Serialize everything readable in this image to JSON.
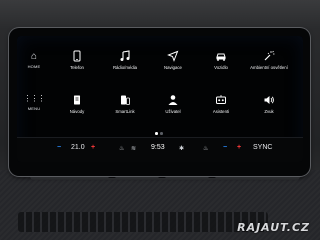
{
  "sidebar": {
    "home_label": "HOME",
    "menu_label": "MENU"
  },
  "apps": [
    {
      "label": "Telefon",
      "icon": "phone-icon"
    },
    {
      "label": "Rádio/média",
      "icon": "music-note-icon"
    },
    {
      "label": "Navigace",
      "icon": "navigation-arrow-icon"
    },
    {
      "label": "Vozidlo",
      "icon": "car-icon"
    },
    {
      "label": "Ambientní osvětlení",
      "icon": "ambient-light-icon"
    },
    {
      "label": "Návody",
      "icon": "manual-icon"
    },
    {
      "label": "SmartLink",
      "icon": "smartlink-icon"
    },
    {
      "label": "Uživatel",
      "icon": "user-icon"
    },
    {
      "label": "Asistenti",
      "icon": "assistant-icon"
    },
    {
      "label": "Zvuk",
      "icon": "speaker-icon"
    }
  ],
  "pager": {
    "pages": 2,
    "active": 1
  },
  "climate": {
    "left_minus": "−",
    "left_temp": "21.0",
    "left_plus": "+",
    "clock": "9:53",
    "right_minus": "−",
    "right_plus": "+",
    "sync_label": "SYNC"
  },
  "colors": {
    "minus": "#2a8cff",
    "plus": "#ff3b3b",
    "pager_active": "#ffffff",
    "pager_inactive": "#5a5d63"
  },
  "watermark": "RAJAUT.CZ"
}
